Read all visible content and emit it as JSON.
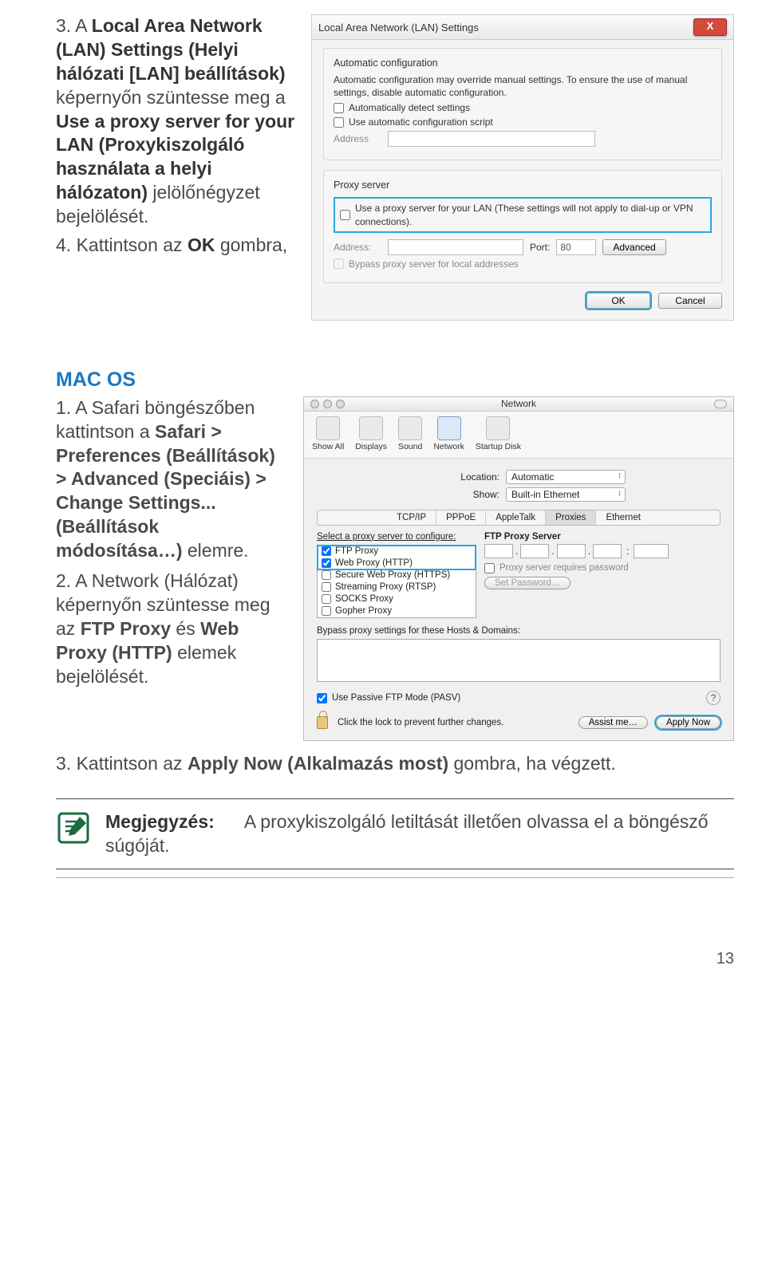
{
  "instructions_top": {
    "item3_pre": "3.  A ",
    "item3_b1": "Local Area Network (LAN) Settings (Helyi hálózati [LAN] beállítások)",
    "item3_mid": " képernyőn szüntesse meg a ",
    "item3_b2": "Use a proxy server for your LAN (Proxykiszolgáló használata a helyi hálózaton)",
    "item3_post": " jelölőnégyzet bejelölését.",
    "item4_pre": "4.  Kattintson az ",
    "item4_b": "OK",
    "item4_post": " gombra,"
  },
  "lan": {
    "title": "Local Area Network (LAN) Settings",
    "close": "X",
    "g1_title": "Automatic configuration",
    "g1_text": "Automatic configuration may override manual settings. To ensure the use of manual settings, disable automatic configuration.",
    "chk_detect": "Automatically detect settings",
    "chk_script": "Use automatic configuration script",
    "addr_label": "Address",
    "g2_title": "Proxy server",
    "chk_proxy": "Use a proxy server for your LAN (These settings will not apply to dial-up or VPN connections).",
    "addr2": "Address:",
    "port_label": "Port:",
    "port_val": "80",
    "advanced": "Advanced",
    "bypass": "Bypass proxy server for local addresses",
    "ok": "OK",
    "cancel": "Cancel"
  },
  "macos_heading": "MAC OS",
  "mac_instr": {
    "s1_pre": "1.  A Safari böngészőben kattintson a ",
    "s1_b": "Safari > Preferences (Beállítások) > Advanced (Speciáis) > Change Settings... (Beállítások módosítása…)",
    "s1_post": " elemre.",
    "s2_pre": "2.  A Network (Hálózat) képernyőn szüntesse meg az ",
    "s2_b": "FTP Proxy",
    "s2_mid": " és ",
    "s2_b2": "Web Proxy (HTTP)",
    "s2_post": " elemek bejelölését."
  },
  "mac": {
    "title": "Network",
    "tb": {
      "showall": "Show All",
      "displays": "Displays",
      "sound": "Sound",
      "network": "Network",
      "startup": "Startup Disk"
    },
    "loc_label": "Location:",
    "loc_val": "Automatic",
    "show_label": "Show:",
    "show_val": "Built-in Ethernet",
    "tabs": {
      "tcpip": "TCP/IP",
      "pppoe": "PPPoE",
      "appletalk": "AppleTalk",
      "proxies": "Proxies",
      "ethernet": "Ethernet"
    },
    "list_head": "Select a proxy server to configure:",
    "proxies": {
      "ftp": "FTP Proxy",
      "web": "Web Proxy (HTTP)",
      "sweb": "Secure Web Proxy (HTTPS)",
      "stream": "Streaming Proxy (RTSP)",
      "socks": "SOCKS Proxy",
      "gopher": "Gopher Proxy"
    },
    "right_head": "FTP Proxy Server",
    "req_pwd": "Proxy server requires password",
    "set_pwd": "Set Password…",
    "bypass": "Bypass proxy settings for these Hosts & Domains:",
    "pasv": "Use Passive FTP Mode (PASV)",
    "locktext": "Click the lock to prevent further changes.",
    "assist": "Assist me…",
    "apply": "Apply Now"
  },
  "step3": {
    "pre": "3.  Kattintson az ",
    "b": "Apply Now (Alkalmazás most)",
    "post": " gombra, ha végzett."
  },
  "note": {
    "label": "Megjegyzés:",
    "text": "A proxykiszolgáló letiltását illetően olvassa el a böngésző súgóját."
  },
  "pagenum": "13"
}
